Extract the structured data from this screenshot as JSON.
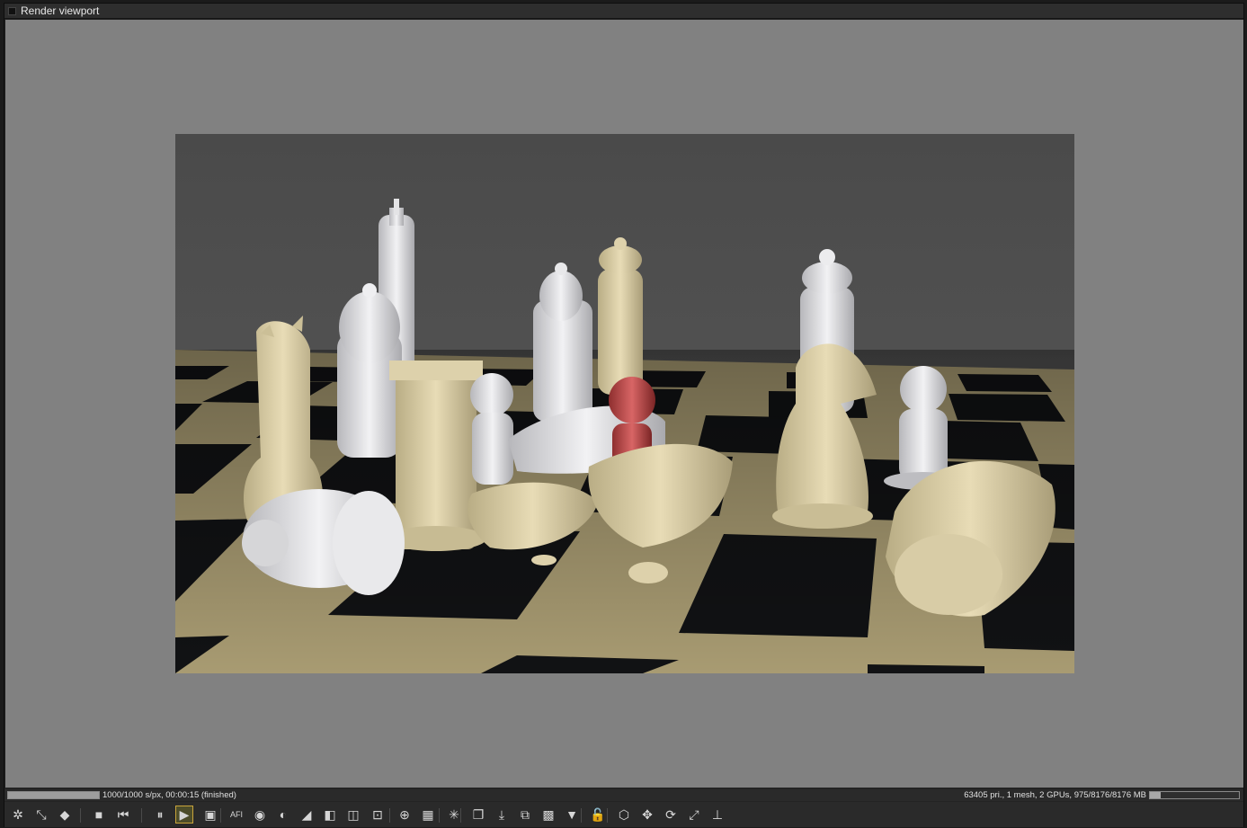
{
  "window": {
    "title": "Render viewport"
  },
  "status": {
    "left_text": "1000/1000 s/px, 00:00:15 (finished)",
    "right_text": "63405 pri., 1 mesh, 2 GPUs, 975/8176/8176 MB",
    "render_progress": 1.0,
    "memory_usage": 0.12
  },
  "toolbar": {
    "buttons": [
      {
        "name": "clay-mode-icon",
        "glyph": "✲"
      },
      {
        "name": "sub-sampling-icon",
        "glyph": "⤡"
      },
      {
        "name": "color-cube-icon",
        "glyph": "◆"
      },
      {
        "name": "stop-render-icon",
        "glyph": "■"
      },
      {
        "name": "restart-render-icon",
        "glyph": "⏮"
      },
      {
        "name": "pause-render-icon",
        "glyph": "⏸"
      },
      {
        "name": "start-render-icon",
        "glyph": "▶"
      },
      {
        "name": "render-region-icon",
        "glyph": "▣"
      },
      {
        "name": "afi-icon",
        "glyph": "AFI"
      },
      {
        "name": "color-picker-icon",
        "glyph": "◉"
      },
      {
        "name": "focus-picker-icon",
        "glyph": "◐"
      },
      {
        "name": "white-balance-icon",
        "glyph": "◢"
      },
      {
        "name": "material-picker-icon",
        "glyph": "◧"
      },
      {
        "name": "object-picker-icon",
        "glyph": "◫"
      },
      {
        "name": "camera-target-icon",
        "glyph": "⊡"
      },
      {
        "name": "zoom-icon",
        "glyph": "⊕"
      },
      {
        "name": "resolution-icon",
        "glyph": "▦"
      },
      {
        "name": "lock-view-icon",
        "glyph": "✳"
      },
      {
        "name": "copy-icon",
        "glyph": "❐"
      },
      {
        "name": "save-icon",
        "glyph": "⤓"
      },
      {
        "name": "layers-icon",
        "glyph": "⧉"
      },
      {
        "name": "checker-icon",
        "glyph": "▩"
      },
      {
        "name": "gradient-icon",
        "glyph": "▼"
      },
      {
        "name": "lock-icon",
        "glyph": "🔓"
      },
      {
        "name": "cube-view-icon",
        "glyph": "⬡"
      },
      {
        "name": "move-icon",
        "glyph": "✥"
      },
      {
        "name": "orbit-icon",
        "glyph": "⟳"
      },
      {
        "name": "fit-view-icon",
        "glyph": "⤢"
      },
      {
        "name": "axis-icon",
        "glyph": "⊥"
      }
    ]
  }
}
